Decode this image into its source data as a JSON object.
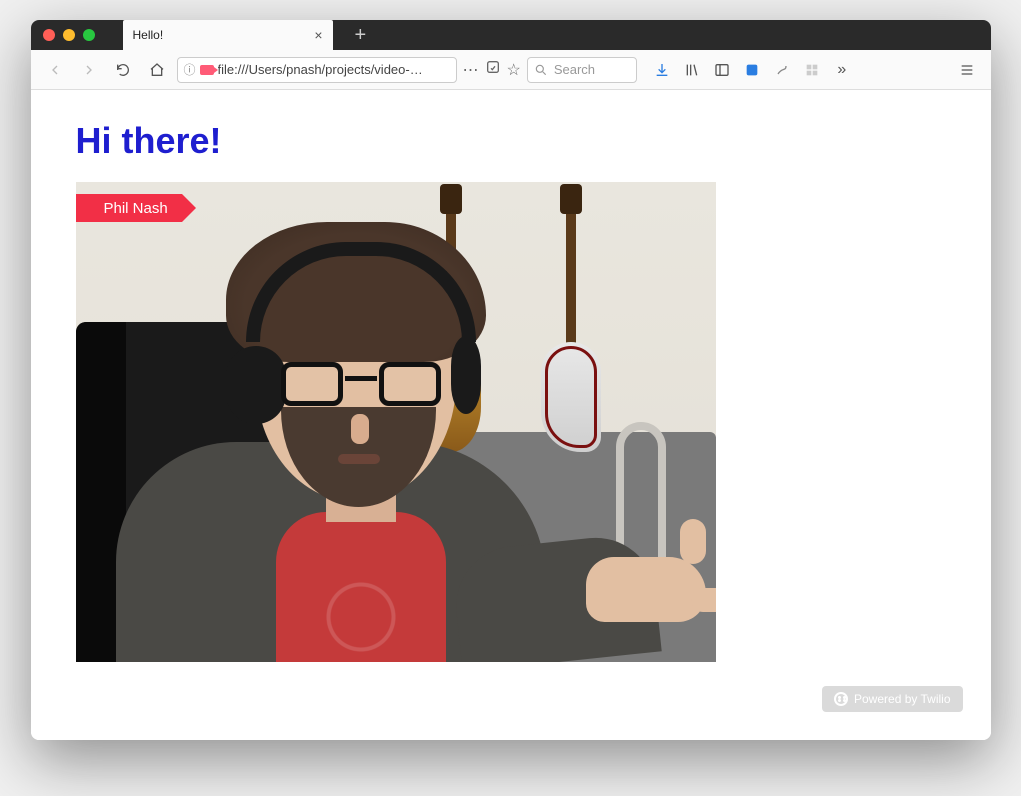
{
  "window": {
    "tab_title": "Hello!",
    "url": "file:///Users/pnash/projects/video-…"
  },
  "toolbar": {
    "search_placeholder": "Search"
  },
  "page": {
    "heading": "Hi there!",
    "participant_name": "Phil Nash",
    "badge_text": "Powered by Twilio"
  },
  "colors": {
    "accent": "#f22f46",
    "heading": "#1e1ecf"
  }
}
